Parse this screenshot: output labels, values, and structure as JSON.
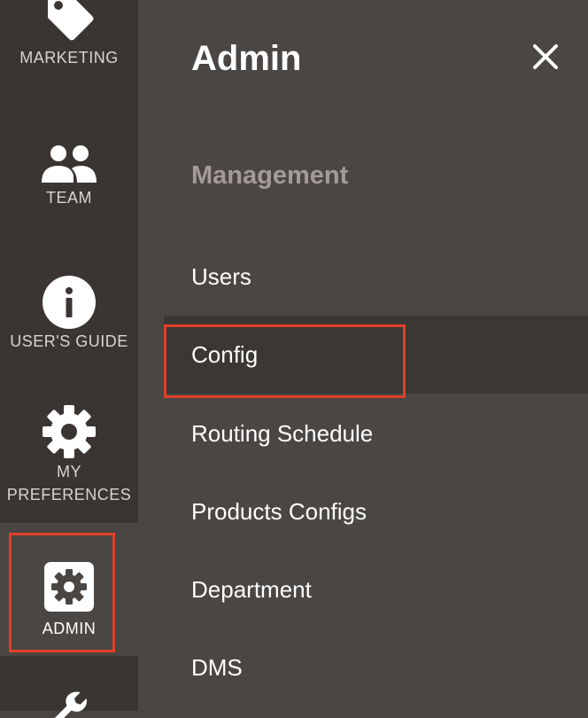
{
  "sidebar": {
    "items": [
      {
        "label": "MARKETING",
        "icon": "tag-icon"
      },
      {
        "label": "TEAM",
        "icon": "people-icon"
      },
      {
        "label": "USER'S GUIDE",
        "icon": "info-icon"
      },
      {
        "label_line1": "MY",
        "label_line2": "PREFERENCES",
        "icon": "gear-icon"
      },
      {
        "label": "ADMIN",
        "icon": "admin-gear-icon",
        "active": true
      },
      {
        "icon": "wrench-icon"
      }
    ]
  },
  "panel": {
    "title": "Admin",
    "section": "Management",
    "items": [
      {
        "label": "Users"
      },
      {
        "label": "Config",
        "active": true
      },
      {
        "label": "Routing Schedule"
      },
      {
        "label": "Products Configs"
      },
      {
        "label": "Department"
      },
      {
        "label": "DMS"
      }
    ]
  },
  "colors": {
    "rail_bg": "#3a3532",
    "panel_bg": "#4a4643",
    "active_bg": "#3b3734",
    "highlight": "#e0402a",
    "section_text": "#a39b95"
  }
}
